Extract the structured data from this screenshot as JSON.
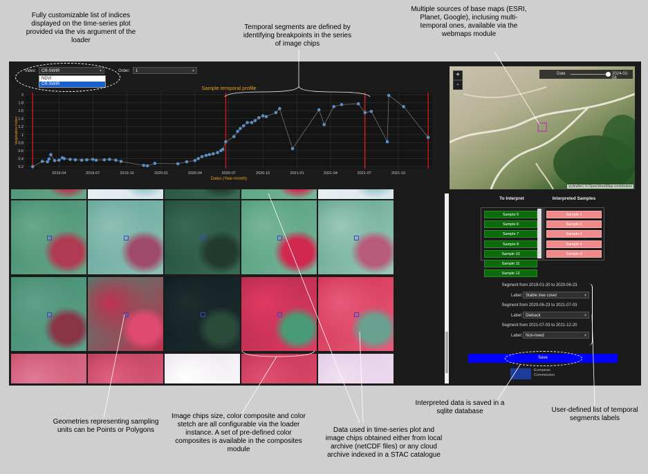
{
  "annotations": {
    "indices": "Fully customizable list of indices\ndisplayed on the time-series plot\nprovided via the vis argument of the\nloader",
    "segments": "Temporal segments are defined by\nidentifying breakpoints in the series\nof image chips",
    "basemaps": "Multiple sources of base maps (ESRI,\nPlanet, Google), inclusing multi-\ntemporal ones, available via the\nwebmaps module",
    "geometries": "Geometries representing sampling\nunits can be Points or Polygons",
    "chips": "Image chips size, color composite and color\nstetch are all configurable via the loader\ninstance. A set of pre-defined color\ncomposites is available in the composites\nmodule",
    "data": "Data used in time-series plot and\nimage chips obtained either from local\narchive (netCDF files) or any cloud\narchive indexed in a STAC catalogue",
    "saved": "Interpreted data is saved in a\nsqlite database",
    "labels": "User-defined list of temporal\nsegments labels"
  },
  "controls": {
    "index_label": "Index:",
    "index_value": "CR-SWIR",
    "index_options": [
      "NDVI",
      "CR-SWIR"
    ],
    "order_label": "Order:",
    "order_value": "1"
  },
  "chart_data": {
    "type": "scatter",
    "title": "Sample temporal profile",
    "xlabel": "Dates (Year-month)",
    "ylabel": "Vegetation Index",
    "ylim": [
      0.15,
      2.05
    ],
    "xlim": [
      "2019-01-01",
      "2021-12-31"
    ],
    "x_ticks": [
      "2019-04",
      "2019-07",
      "2019-10",
      "2020-01",
      "2020-04",
      "2020-07",
      "2020-10",
      "2021-01",
      "2021-04",
      "2021-07",
      "2021-10"
    ],
    "y_ticks": [
      0.2,
      0.4,
      0.6,
      0.8,
      1,
      1.2,
      1.4,
      1.6,
      1.8,
      2
    ],
    "y_tick_labels": [
      "0.2",
      "0.4",
      "0.6",
      "0.8",
      "1",
      "1.2",
      "1.4",
      "1.6",
      "1.8",
      "2"
    ],
    "breakpoints": [
      "2019-01-20",
      "2020-06-23",
      "2021-07-03",
      "2021-12-20"
    ],
    "points": [
      [
        "2019-01-20",
        0.2
      ],
      [
        "2019-02-15",
        0.33
      ],
      [
        "2019-03-01",
        0.32
      ],
      [
        "2019-03-05",
        0.39
      ],
      [
        "2019-03-10",
        0.5
      ],
      [
        "2019-03-20",
        0.35
      ],
      [
        "2019-04-01",
        0.36
      ],
      [
        "2019-04-10",
        0.42
      ],
      [
        "2019-04-15",
        0.4
      ],
      [
        "2019-05-01",
        0.38
      ],
      [
        "2019-05-15",
        0.37
      ],
      [
        "2019-06-01",
        0.36
      ],
      [
        "2019-06-15",
        0.37
      ],
      [
        "2019-07-01",
        0.38
      ],
      [
        "2019-07-10",
        0.36
      ],
      [
        "2019-08-01",
        0.37
      ],
      [
        "2019-08-15",
        0.38
      ],
      [
        "2019-09-01",
        0.36
      ],
      [
        "2019-09-15",
        0.33
      ],
      [
        "2019-11-15",
        0.23
      ],
      [
        "2019-11-25",
        0.22
      ],
      [
        "2019-12-15",
        0.28
      ],
      [
        "2020-02-15",
        0.27
      ],
      [
        "2020-03-10",
        0.32
      ],
      [
        "2020-04-01",
        0.35
      ],
      [
        "2020-04-10",
        0.4
      ],
      [
        "2020-04-20",
        0.45
      ],
      [
        "2020-05-01",
        0.48
      ],
      [
        "2020-05-10",
        0.5
      ],
      [
        "2020-05-20",
        0.52
      ],
      [
        "2020-06-01",
        0.55
      ],
      [
        "2020-06-10",
        0.6
      ],
      [
        "2020-06-15",
        0.63
      ],
      [
        "2020-06-23",
        0.82
      ],
      [
        "2020-07-15",
        0.95
      ],
      [
        "2020-07-25",
        1.08
      ],
      [
        "2020-08-01",
        1.15
      ],
      [
        "2020-08-10",
        1.22
      ],
      [
        "2020-08-20",
        1.3
      ],
      [
        "2020-09-01",
        1.3
      ],
      [
        "2020-09-10",
        1.35
      ],
      [
        "2020-09-20",
        1.42
      ],
      [
        "2020-10-01",
        1.47
      ],
      [
        "2020-10-10",
        1.45
      ],
      [
        "2020-11-05",
        1.55
      ],
      [
        "2020-11-15",
        1.65
      ],
      [
        "2020-12-20",
        0.65
      ],
      [
        "2021-03-01",
        1.62
      ],
      [
        "2021-03-15",
        1.25
      ],
      [
        "2021-04-10",
        1.7
      ],
      [
        "2021-05-01",
        1.75
      ],
      [
        "2021-06-15",
        1.77
      ],
      [
        "2021-07-03",
        1.55
      ],
      [
        "2021-07-20",
        1.58
      ],
      [
        "2021-09-01",
        0.82
      ],
      [
        "2021-09-05",
        1.98
      ],
      [
        "2021-10-15",
        1.7
      ],
      [
        "2021-12-20",
        0.93
      ]
    ]
  },
  "map": {
    "date_label": "Date",
    "date_value": "2024-02-08",
    "zoom_in": "+",
    "zoom_out": "-",
    "attribution": "ipyleaflet | © OpenStreetMap contributors"
  },
  "samples": {
    "to_interpret_title": "To Interpret",
    "interpreted_title": "Interpreted Samples",
    "to_interpret": [
      "Sample 5",
      "Sample 6",
      "Sample 7",
      "Sample 8",
      "Sample 10",
      "Sample 11",
      "Sample 12"
    ],
    "interpreted": [
      "Sample 1",
      "Sample 2",
      "Sample 3",
      "Sample 4",
      "Sample 9"
    ]
  },
  "segments": [
    {
      "title": "Segment from 2019-01-20 to 2020-06-23",
      "label_text": "Label:",
      "value": "Stable tree cover"
    },
    {
      "title": "Segment from 2020-06-23 to 2021-07-03",
      "label_text": "Label:",
      "value": "Dieback"
    },
    {
      "title": "Segment from 2021-07-03 to 2021-12-20",
      "label_text": "Label:",
      "value": "Non-treed"
    }
  ],
  "save_label": "Save",
  "logo_text": "European\nCommission",
  "colors": {
    "accent_orange": "#e8a020",
    "breakpoint_red": "#d01818",
    "point_blue": "#5b90c4",
    "save_blue": "#0000ff"
  }
}
